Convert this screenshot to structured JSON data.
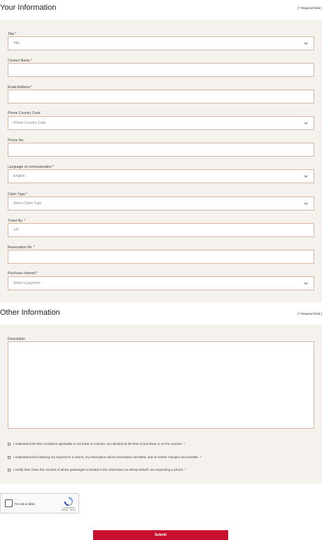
{
  "section1": {
    "title": "Your Information",
    "required_note": "(* Required field )"
  },
  "fields": {
    "title": {
      "label": "Title",
      "value": "Title"
    },
    "contact_name": {
      "label": "Contact Name",
      "value": ""
    },
    "email": {
      "label": "Email Address",
      "value": ""
    },
    "phone_country_code": {
      "label": "Phone Country Code",
      "value": "Phone Country Code"
    },
    "phone_no": {
      "label": "Phone No.",
      "value": ""
    },
    "language": {
      "label": "Language of communication",
      "value": "English"
    },
    "claim_type": {
      "label": "Claim Type",
      "value": "Select Claim Type"
    },
    "ticket_no": {
      "label": "Ticket No.",
      "value": "147"
    },
    "reservation_no": {
      "label": "Reservation No.",
      "value": ""
    },
    "purchase_channel": {
      "label": "Purchase channel",
      "value": "Select a payment"
    }
  },
  "section2": {
    "title": "Other Information",
    "required_note": "(* Required field )",
    "description_label": "Description"
  },
  "checks": [
    "I understand the fare conditions applicable to my ticket or voucher, as indicated at the time of purchase or on the voucher.",
    "I understand that following my request for a refund, my reservation will be irreversibly cancelled, and no further changes are possible.",
    "I certify that I have the consent of all the passengers included in the reservation on whose behalf I am requesting a refund."
  ],
  "captcha": {
    "label": "I'm not a robot",
    "brand": "reCAPTCHA",
    "links": "Privacy - Terms"
  },
  "submit_label": "Submit",
  "colors": {
    "accent": "#c8102e",
    "panel": "#f5f1ec",
    "border": "#d9b7a4"
  }
}
